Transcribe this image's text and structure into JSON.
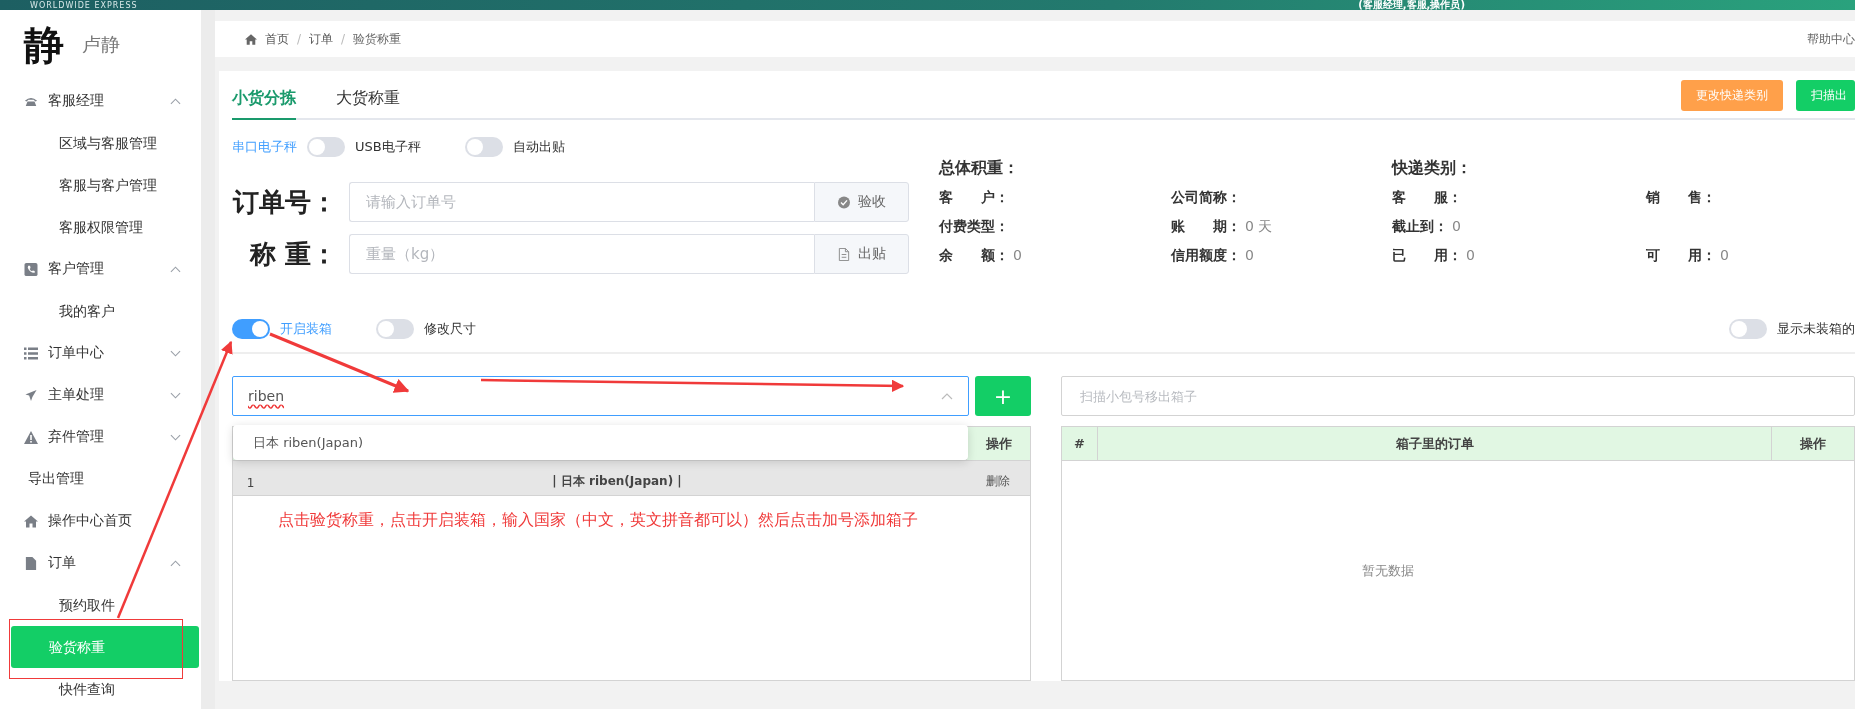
{
  "banner": {
    "brand": "WORLDWIDE EXPRESS",
    "roles": "(客服经理,客服,操作员)"
  },
  "user": {
    "logo": "静",
    "name": "卢静"
  },
  "sidebar": {
    "items": [
      {
        "label": "客服经理",
        "expanded": true,
        "children": [
          {
            "label": "区域与客服管理",
            "selected": false
          },
          {
            "label": "客服与客户管理",
            "selected": false
          },
          {
            "label": "客服权限管理",
            "selected": false
          }
        ]
      },
      {
        "label": "客户管理",
        "expanded": true,
        "children": [
          {
            "label": "我的客户",
            "selected": false
          }
        ]
      },
      {
        "label": "订单中心",
        "expanded": false
      },
      {
        "label": "主单处理",
        "expanded": false
      },
      {
        "label": "弃件管理",
        "expanded": false
      },
      {
        "label": "导出管理"
      },
      {
        "label": "操作中心首页"
      },
      {
        "label": "订单",
        "expanded": true,
        "children": [
          {
            "label": "预约取件",
            "selected": false
          },
          {
            "label": "验货称重",
            "selected": true
          },
          {
            "label": "快件查询",
            "selected": false
          }
        ]
      }
    ]
  },
  "breadcrumb": [
    "首页",
    "订单",
    "验货称重"
  ],
  "breadcrumb_separator": "/",
  "help_link": "帮助中心",
  "tabs": [
    {
      "label": "小货分拣",
      "selected": true
    },
    {
      "label": "大货称重",
      "selected": false
    }
  ],
  "header_buttons": [
    {
      "label": "更改快递类别",
      "kind": "warning"
    },
    {
      "label": "扫描出",
      "kind": "primary"
    }
  ],
  "scale_switch": {
    "left_label": "串口电子秤",
    "right_label": "USB电子秤",
    "on": false
  },
  "auto_print": {
    "label": "自动出贴",
    "on": false
  },
  "order_field": {
    "label": "订单号：",
    "placeholder": "请输入订单号",
    "button": "验收"
  },
  "weight_field": {
    "label": "称 重：",
    "placeholder": "重量（kg）",
    "button": "出贴"
  },
  "info": {
    "titles": [
      "总体积重：",
      "快递类别："
    ],
    "rows": [
      [
        {
          "label": "客　　户："
        },
        {
          "label": "公司简称："
        },
        {
          "label": "客　　服："
        },
        {
          "label": "销　　售："
        }
      ],
      [
        {
          "label": "付费类型："
        },
        {
          "label": "账　　期：",
          "value": "0 天"
        },
        {
          "label": "截止到：",
          "value": "0"
        }
      ],
      [
        {
          "label": "余　　额：",
          "value": "0"
        },
        {
          "label": "信用额度：",
          "value": "0"
        },
        {
          "label": "已　　用：",
          "value": "0"
        },
        {
          "label": "可　　用：",
          "value": "0"
        }
      ]
    ]
  },
  "packing_switches": [
    {
      "label": "开启装箱",
      "on": true
    },
    {
      "label": "修改尺寸",
      "on": false
    }
  ],
  "show_unpacked": {
    "label": "显示未装箱的",
    "on": false
  },
  "box_select": {
    "value": "riben",
    "open": true,
    "options": [
      "日本 riben(Japan)"
    ]
  },
  "add_button": "+",
  "box_table": {
    "action_header": "操作",
    "rows": [
      {
        "index": "1",
        "name": "| 日本 riben(Japan) |",
        "action": "删除"
      }
    ]
  },
  "annotation": "点击验货称重，点击开启装箱，输入国家（中文，英文拼音都可以）然后点击加号添加箱子",
  "scan_field": {
    "placeholder": "扫描小包号移出箱子"
  },
  "order_table": {
    "columns": [
      "#",
      "箱子里的订单",
      "操作"
    ],
    "empty": "暂无数据"
  }
}
